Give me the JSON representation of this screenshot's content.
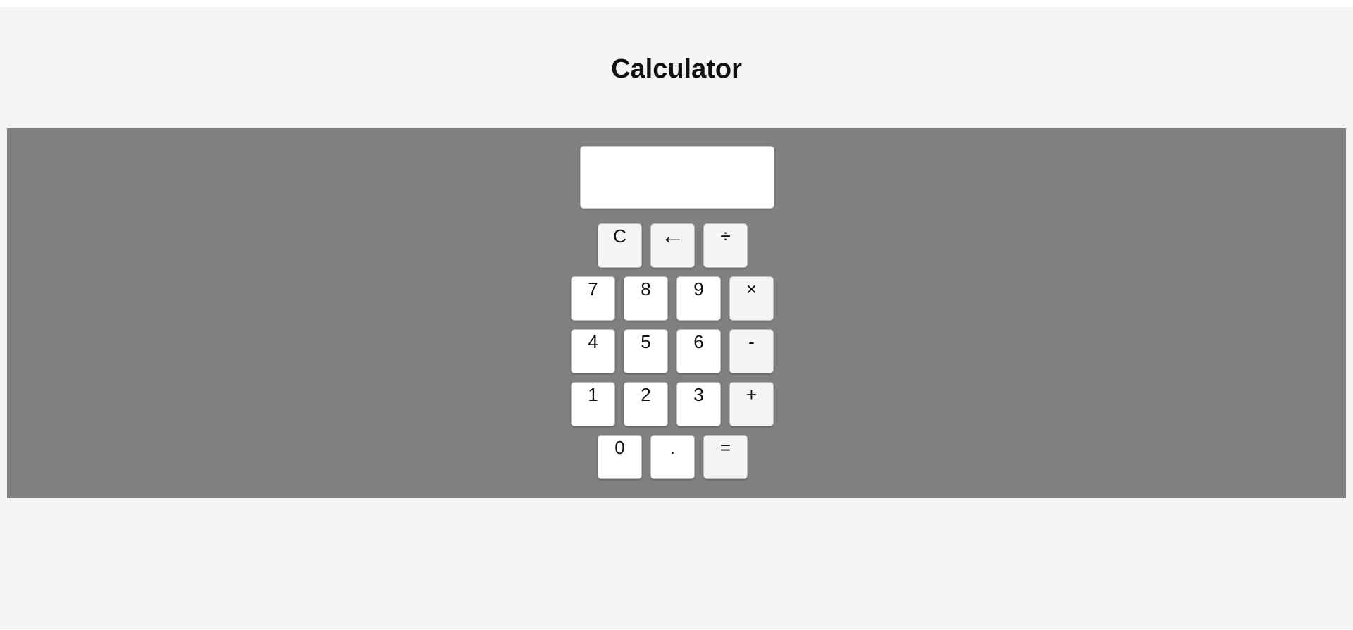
{
  "page": {
    "title": "Calculator"
  },
  "display": {
    "value": ""
  },
  "keys": {
    "clear": "C",
    "backspace": "←",
    "divide": "÷",
    "seven": "7",
    "eight": "8",
    "nine": "9",
    "multiply": "×",
    "four": "4",
    "five": "5",
    "six": "6",
    "subtract": "-",
    "one": "1",
    "two": "2",
    "three": "3",
    "add": "+",
    "zero": "0",
    "decimal": ".",
    "equals": "="
  },
  "colors": {
    "page_background": "#f4f4f4",
    "panel_background": "#808080",
    "number_key": "#ffffff",
    "operator_key": "#f4f4f4"
  }
}
